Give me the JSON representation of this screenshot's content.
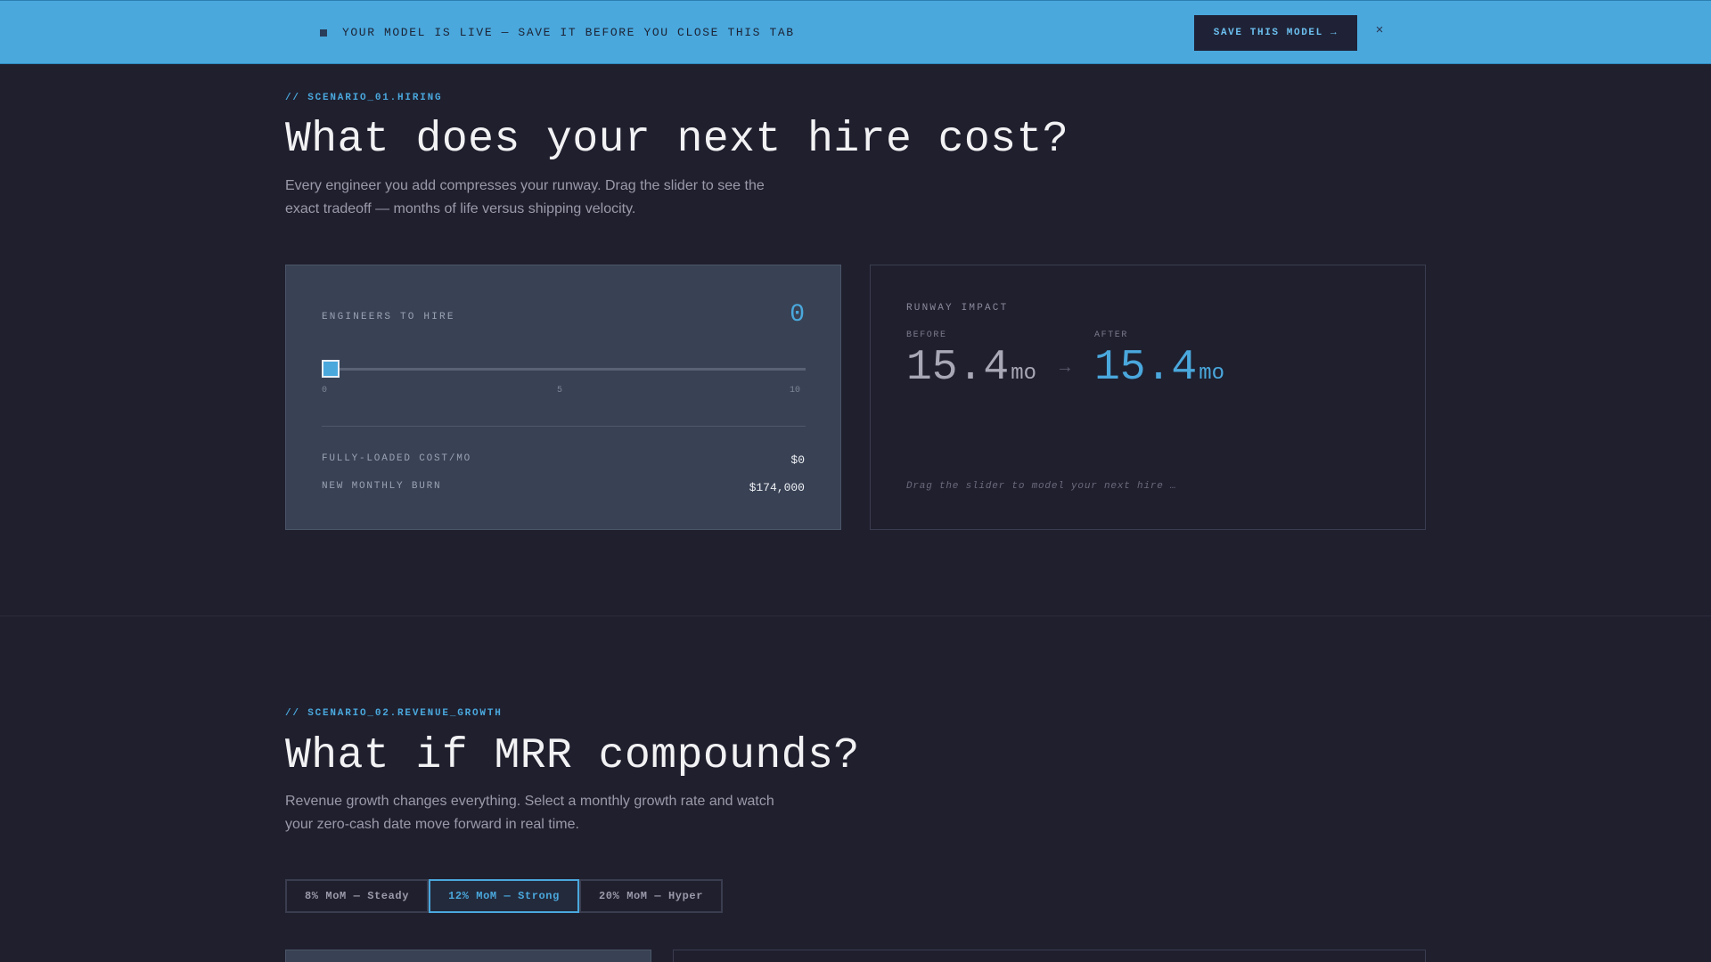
{
  "banner": {
    "text": "YOUR MODEL IS LIVE — SAVE IT BEFORE YOU CLOSE THIS TAB",
    "save_label": "SAVE THIS MODEL →",
    "close_label": "×"
  },
  "scenario1": {
    "eyebrow": "// SCENARIO_01.HIRING",
    "heading": "What does your next hire cost?",
    "description": "Every engineer you add compresses your runway. Drag the slider to see the exact tradeoff — months of life versus shipping velocity.",
    "hire_card": {
      "label": "ENGINEERS TO HIRE",
      "value": "0",
      "slider": {
        "min": 0,
        "max": 10,
        "value": 0
      },
      "ticks": [
        "0",
        "5",
        "10"
      ],
      "cost_label": "FULLY-LOADED COST/MO",
      "cost_value": "$0",
      "burn_label": "NEW MONTHLY BURN",
      "burn_value": "$174,000"
    },
    "runway_card": {
      "label": "RUNWAY IMPACT",
      "before_label": "BEFORE",
      "before_value": "15.4",
      "after_label": "AFTER",
      "after_value": "15.4",
      "unit": "mo",
      "arrow": "→",
      "hint": "Drag the slider to model your next hire …"
    }
  },
  "scenario2": {
    "eyebrow": "// SCENARIO_02.REVENUE_GROWTH",
    "heading": "What if MRR compounds?",
    "description": "Revenue growth changes everything. Select a monthly growth rate and watch your zero-cash date move forward in real time.",
    "tabs": [
      {
        "label": "8% MoM — Steady",
        "selected": false
      },
      {
        "label": "12% MoM — Strong",
        "selected": true
      },
      {
        "label": "20% MoM — Hyper",
        "selected": false
      }
    ]
  },
  "colors": {
    "background": "#1f1f2e",
    "accent": "#4aa8dd",
    "card": "#394255",
    "banner": "#4aa8dd"
  }
}
